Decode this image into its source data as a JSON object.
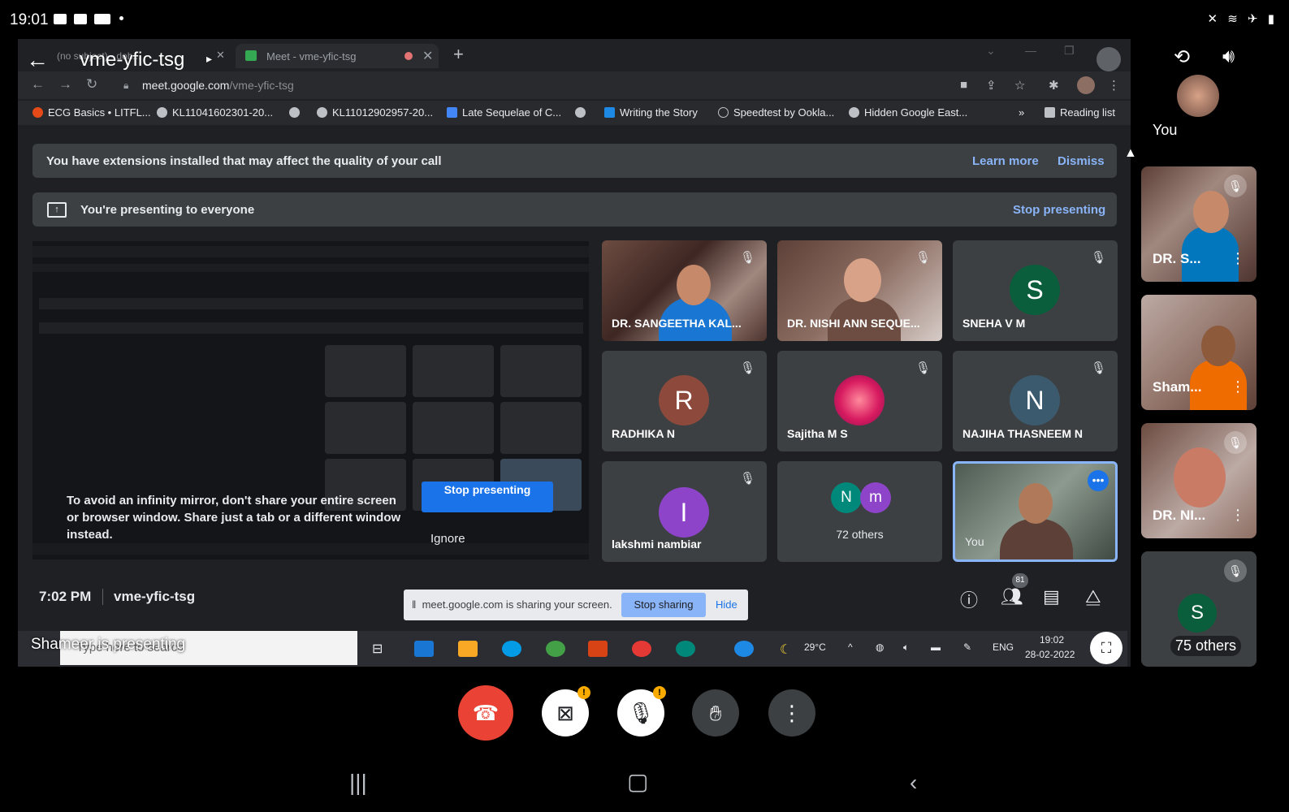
{
  "status_bar": {
    "time": "19:01"
  },
  "meeting": {
    "code_title": "vme-yfic-tsg",
    "time": "7:02 PM",
    "code": "vme-yfic-tsg"
  },
  "browser": {
    "tab1_label": "(no subject) - doh...",
    "tab2_label": "Meet - vme-yfic-tsg",
    "url_domain": "meet.google.com",
    "url_path": "/vme-yfic-tsg",
    "bookmarks": [
      "ECG Basics • LITFL...",
      "KL11041602301-20...",
      "KL11012902957-20...",
      "Late Sequelae of C...",
      "Writing the Story",
      "Speedtest by Ookla...",
      "Hidden Google East..."
    ],
    "reading_list": "Reading list",
    "more": "»"
  },
  "extension_banner": {
    "text": "You have extensions installed that may affect the quality of your call",
    "learn_more": "Learn more",
    "dismiss": "Dismiss"
  },
  "presenting_banner": {
    "text": "You're presenting to everyone",
    "stop": "Stop presenting"
  },
  "infinity_mirror": {
    "text": "To avoid an infinity mirror, don't share your entire screen or browser window. Share just a tab or a different window instead.",
    "stop_button": "Stop presenting",
    "ignore": "Ignore"
  },
  "participants": [
    {
      "name": "DR. SANGEETHA KAL...",
      "type": "video",
      "muted": true
    },
    {
      "name": "DR. NISHI ANN SEQUE...",
      "type": "video",
      "muted": true
    },
    {
      "name": "SNEHA V M",
      "type": "letter",
      "letter": "S",
      "color": "#0b5e3c",
      "muted": true
    },
    {
      "name": "RADHIKA N",
      "type": "letter",
      "letter": "R",
      "color": "#8d4a3c",
      "muted": true
    },
    {
      "name": "Sajitha M S",
      "type": "image",
      "muted": true
    },
    {
      "name": "NAJIHA THASNEEM N",
      "type": "letter",
      "letter": "N",
      "color": "#3c5a6e",
      "muted": true
    },
    {
      "name": "lakshmi nambiar",
      "type": "letter",
      "letter": "I",
      "color": "#8e44c8",
      "muted": true
    },
    {
      "name": "72 others",
      "type": "group",
      "letters": [
        "N",
        "m"
      ]
    },
    {
      "name": "You",
      "type": "video",
      "active": true
    }
  ],
  "people_count": "81",
  "share_notice": {
    "text": "meet.google.com is sharing your screen.",
    "stop": "Stop sharing",
    "hide": "Hide"
  },
  "taskbar": {
    "search_placeholder": "Type here to search",
    "weather": "29°C",
    "lang": "ENG",
    "time": "19:02",
    "date": "28-02-2022"
  },
  "presenting_label": "Shameer is presenting",
  "right_column": [
    {
      "name": "You"
    },
    {
      "name": "DR. S..."
    },
    {
      "name": "Sham..."
    },
    {
      "name": "DR. NI..."
    },
    {
      "name": "75 others",
      "letter": "S"
    }
  ]
}
